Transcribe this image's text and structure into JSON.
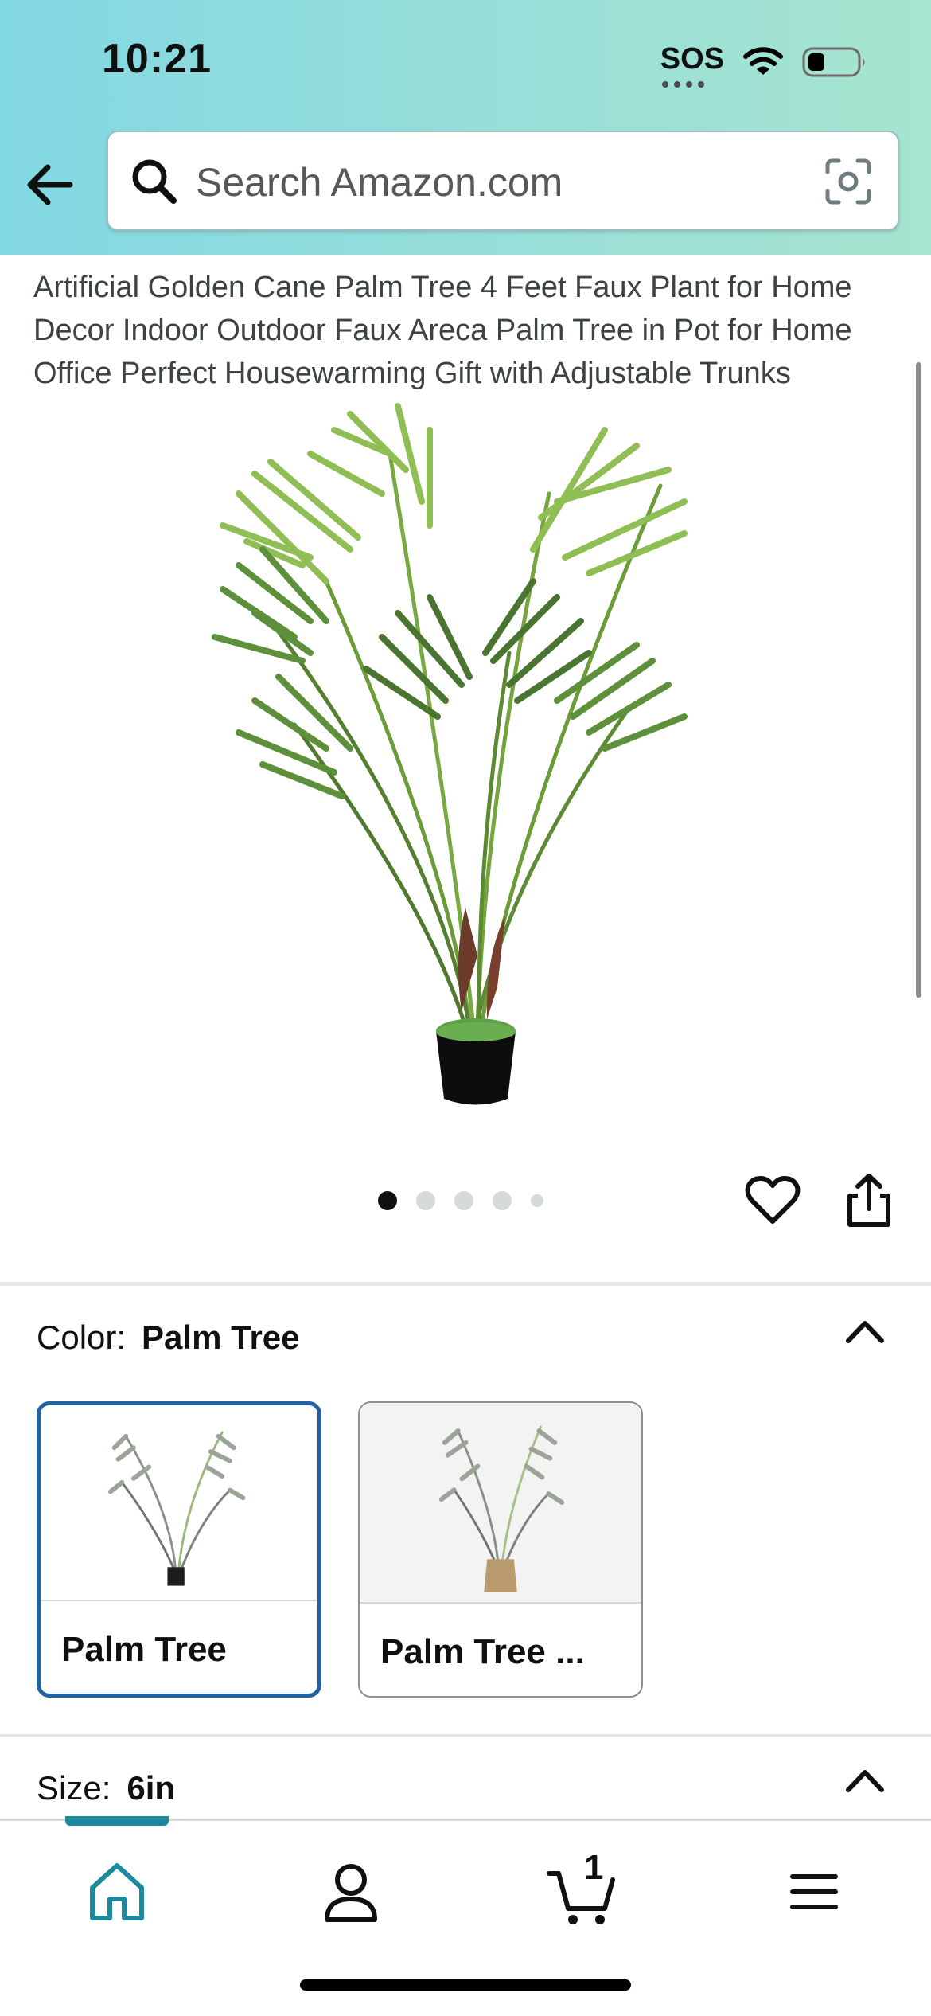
{
  "status_bar": {
    "time": "10:21",
    "sos": "SOS"
  },
  "search": {
    "placeholder": "Search Amazon.com"
  },
  "product": {
    "title": "Artificial Golden Cane Palm Tree 4 Feet Faux Plant for Home Decor Indoor Outdoor Faux Areca Palm Tree in Pot for Home Office Perfect Housewarming Gift with Adjustable Trunks"
  },
  "gallery": {
    "image_count": 5,
    "active_index": 0
  },
  "color": {
    "label": "Color:",
    "selected": "Palm Tree",
    "options": [
      {
        "label": "Palm Tree",
        "selected": true
      },
      {
        "label": "Palm Tree ...",
        "selected": false
      }
    ]
  },
  "size": {
    "label": "Size:",
    "selected": "6in"
  },
  "nav": {
    "cart_count": "1"
  },
  "icons": {
    "back": "back-arrow-icon",
    "search": "search-icon",
    "camera": "camera-scan-icon",
    "heart": "heart-icon",
    "share": "share-icon",
    "home": "home-icon",
    "account": "account-icon",
    "cart": "cart-icon",
    "menu": "menu-icon"
  },
  "colors": {
    "accent": "#1b8a9e",
    "selection": "#2162a1"
  }
}
